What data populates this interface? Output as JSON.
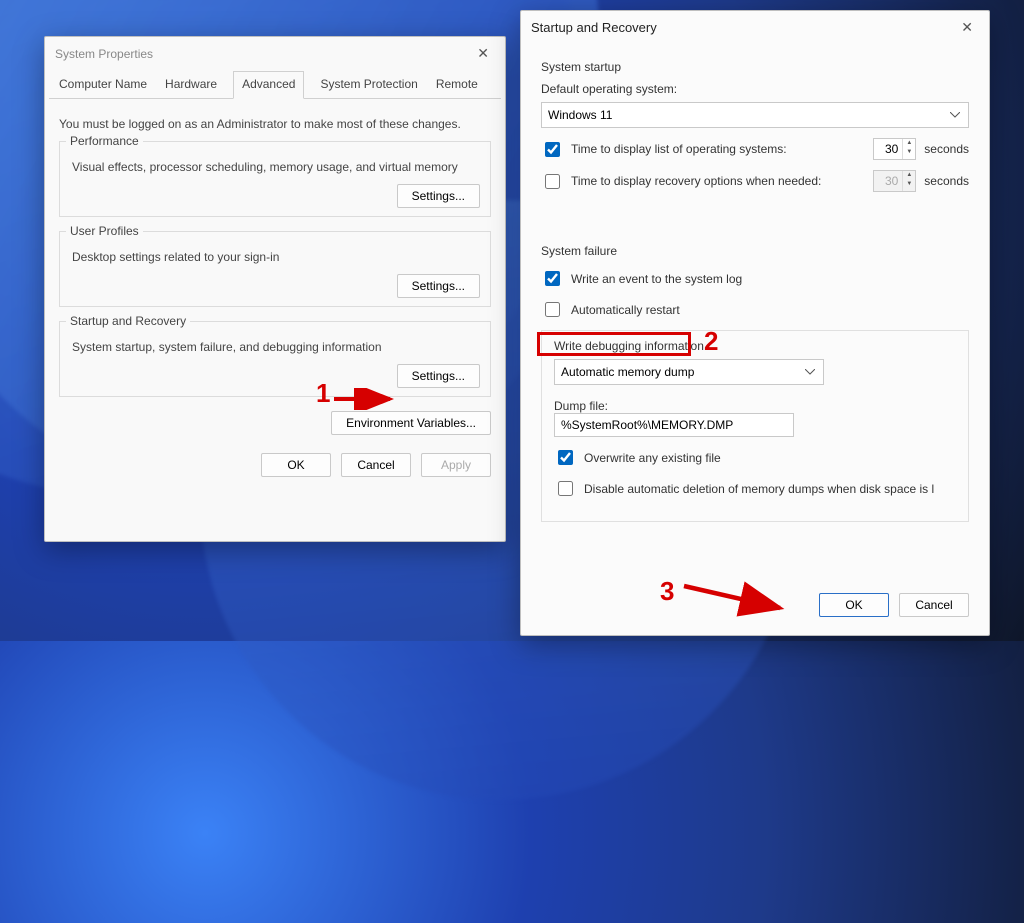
{
  "sysprops": {
    "title": "System Properties",
    "tabs": [
      "Computer Name",
      "Hardware",
      "Advanced",
      "System Protection",
      "Remote"
    ],
    "active_tab_index": 2,
    "note": "You must be logged on as an Administrator to make most of these changes.",
    "perf": {
      "title": "Performance",
      "desc": "Visual effects, processor scheduling, memory usage, and virtual memory",
      "button": "Settings..."
    },
    "profiles": {
      "title": "User Profiles",
      "desc": "Desktop settings related to your sign-in",
      "button": "Settings..."
    },
    "startup": {
      "title": "Startup and Recovery",
      "desc": "System startup, system failure, and debugging information",
      "button": "Settings..."
    },
    "env_button": "Environment Variables...",
    "ok": "OK",
    "cancel": "Cancel",
    "apply": "Apply"
  },
  "startup_dlg": {
    "title": "Startup and Recovery",
    "startup_section": "System startup",
    "default_os_label": "Default operating system:",
    "default_os_value": "Windows 11",
    "time_list_label": "Time to display list of operating systems:",
    "time_list_value": "30",
    "time_list_checked": true,
    "time_recovery_label": "Time to display recovery options when needed:",
    "time_recovery_value": "30",
    "time_recovery_checked": false,
    "seconds": "seconds",
    "failure_section": "System failure",
    "write_event_label": "Write an event to the system log",
    "write_event_checked": true,
    "auto_restart_label": "Automatically restart",
    "auto_restart_checked": false,
    "debug_title": "Write debugging information",
    "debug_select": "Automatic memory dump",
    "dump_label": "Dump file:",
    "dump_value": "%SystemRoot%\\MEMORY.DMP",
    "overwrite_label": "Overwrite any existing file",
    "overwrite_checked": true,
    "disable_delete_label": "Disable automatic deletion of memory dumps when disk space is l",
    "disable_delete_checked": false,
    "ok": "OK",
    "cancel": "Cancel"
  },
  "annotations": {
    "n1": "1",
    "n2": "2",
    "n3": "3"
  }
}
